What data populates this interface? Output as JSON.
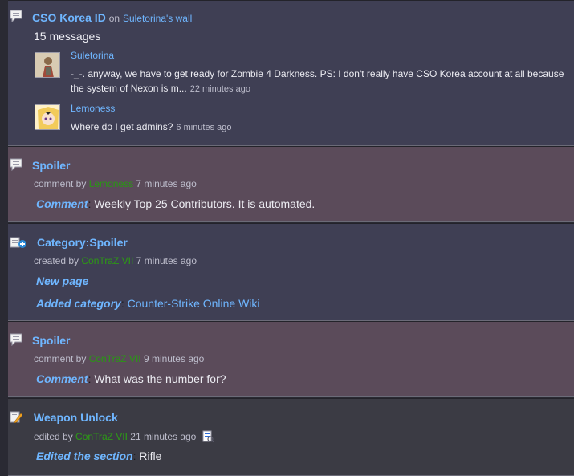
{
  "items": [
    {
      "title": "CSO Korea ID",
      "on_word": "on",
      "wall_link": "Suletorina's wall",
      "message_count": "15 messages",
      "replies": [
        {
          "user": "Suletorina",
          "text_line1": "-_-. anyway, we have to get ready for Zombie 4 Darkness.  PS: I don't really have CSO Korea account at all because",
          "text_line2": "the system of Nexon is m...",
          "time": "22 minutes ago"
        },
        {
          "user": "Lemoness",
          "text_line1": "Where do I get admins?",
          "time": "6 minutes ago"
        }
      ]
    },
    {
      "title": "Spoiler",
      "meta_prefix": "comment by",
      "user": "Lemoness",
      "time": "7 minutes ago",
      "label": "Comment",
      "label_sep": ":",
      "text": "Weekly Top 25 Contributors. It is automated."
    },
    {
      "title": "Category:Spoiler",
      "meta_prefix": "created by",
      "user": "ConTraZ VII",
      "time": "7 minutes ago",
      "label1": "New page",
      "label2": "Added category",
      "label2_sep": ":",
      "link": "Counter-Strike Online Wiki"
    },
    {
      "title": "Spoiler",
      "meta_prefix": "comment by",
      "user": "ConTraZ VII",
      "time": "9 minutes ago",
      "label": "Comment",
      "label_sep": ":",
      "text": "What was the number for?"
    },
    {
      "title": "Weapon Unlock",
      "meta_prefix": "edited by",
      "user": "ConTraZ VII",
      "time": "21 minutes ago",
      "label": "Edited the section",
      "label_sep": ":",
      "text": "Rifle",
      "diff_icon": "diff-icon"
    }
  ],
  "icons": {
    "talk": "speech-bubble-icon",
    "category": "new-category-icon",
    "edit": "edit-pencil-icon",
    "diff": "diff-page-icon"
  },
  "colors": {
    "link": "#6fb6ff",
    "user": "#2f8f1c",
    "panel_blue": "#3f3f54",
    "panel_mauve": "#5b4b5a",
    "panel_dark": "#3b3b44"
  }
}
